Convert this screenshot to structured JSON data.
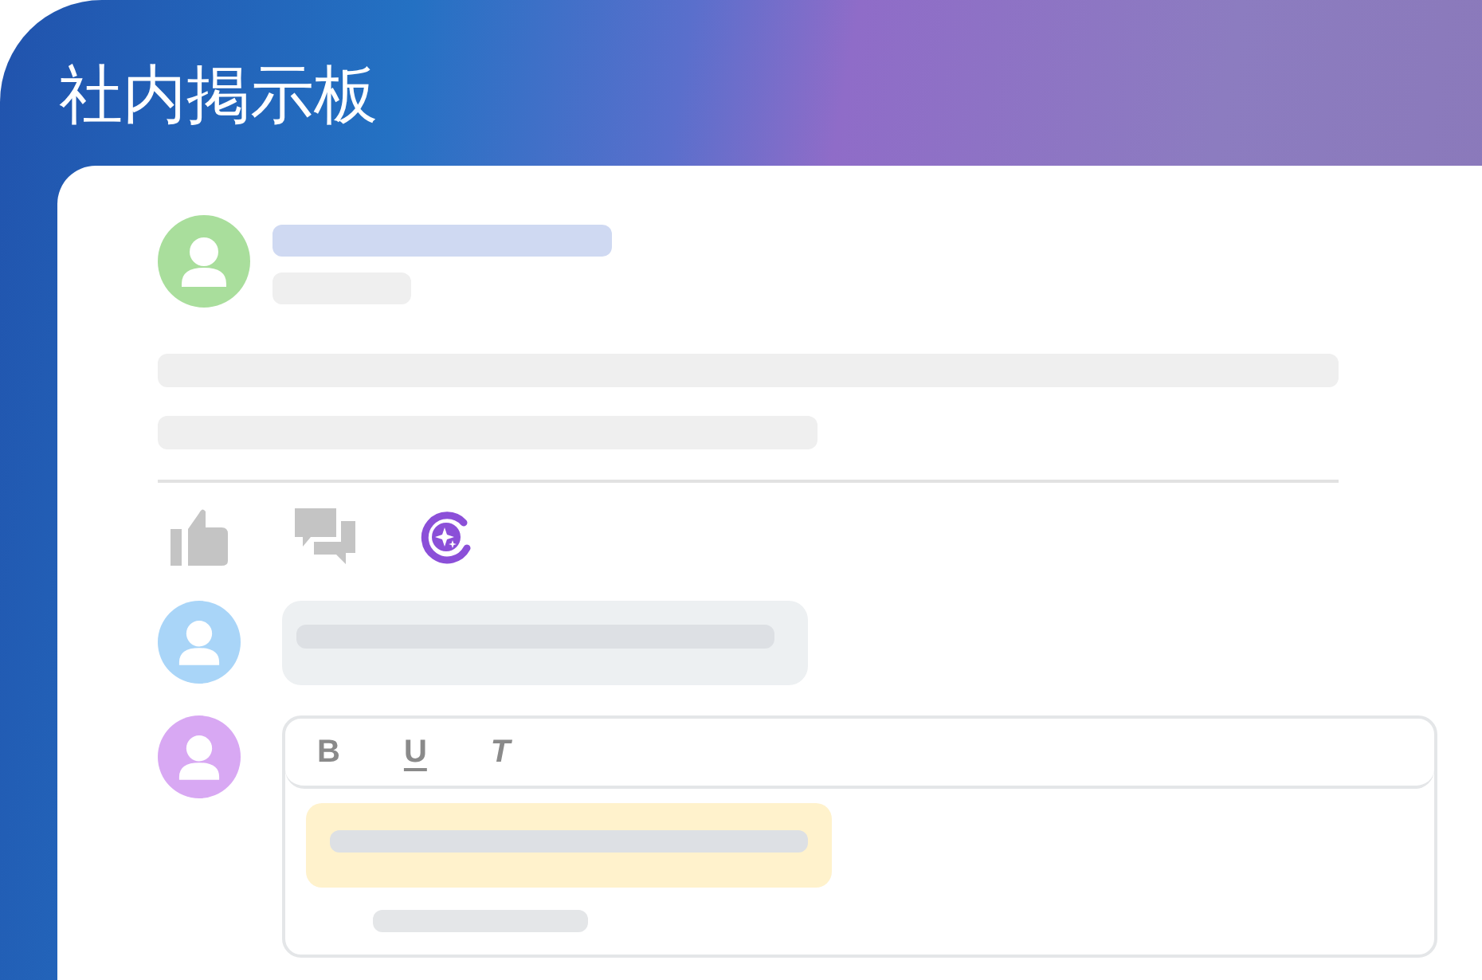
{
  "header": {
    "title": "社内掲示板"
  },
  "editor": {
    "toolbar": [
      {
        "kind": "bold",
        "label": "B"
      },
      {
        "kind": "underline",
        "label": "U"
      },
      {
        "kind": "italic",
        "label": "T"
      }
    ]
  }
}
